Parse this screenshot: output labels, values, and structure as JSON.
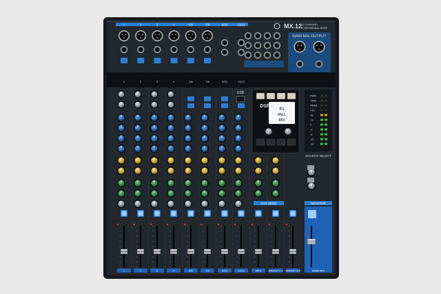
{
  "brand": {
    "model": "MX.12",
    "subtitle_line1": "12 CHANNEL",
    "subtitle_line2": "PROFESSIONAL MIXER"
  },
  "top_channel_labels": [
    "1",
    "2",
    "3",
    "4",
    "5/6",
    "7/8",
    "9/10",
    "11/12"
  ],
  "bottom_channel_labels": [
    "1",
    "2",
    "3",
    "4",
    "5/6",
    "7/8",
    "9/10",
    "11/12"
  ],
  "main_mix_output_label": "MAIN MIX OUTPUT",
  "usb_label": "USB",
  "dsp": {
    "label": "DSP",
    "display_lines": [
      "01",
      "HALL",
      "REV"
    ],
    "button_count": 8
  },
  "meter": {
    "labels": [
      "PWR",
      "+48V",
      "PEAK",
      "+10",
      "+6",
      "+3",
      "0",
      "-3",
      "-6",
      "-10",
      "-20"
    ],
    "left_level": 0.72,
    "right_level": 0.72
  },
  "aux_send_label": "AUX SEND",
  "source_select_label": "SOURCE SELECT",
  "monitor_label": "MONITOR",
  "fader_strips": [
    {
      "label": "1",
      "level": 0.38
    },
    {
      "label": "2",
      "level": 0.38
    },
    {
      "label": "3",
      "level": 0.38
    },
    {
      "label": "4",
      "level": 0.38
    },
    {
      "label": "5/6",
      "level": 0.38
    },
    {
      "label": "7/8",
      "level": 0.38
    },
    {
      "label": "9/10",
      "level": 0.38
    },
    {
      "label": "11/12",
      "level": 0.38
    },
    {
      "label": "DFX",
      "level": 0.38
    },
    {
      "label": "GROUP 1-2",
      "level": 0.38
    },
    {
      "label": "GROUP 3-4",
      "level": 0.38
    }
  ],
  "main_mix_fader": {
    "label": "MAIN MIX",
    "level": 0.62
  },
  "colors": {
    "body": "#20252a",
    "accent_blue": "#2a7fd4",
    "knob_blue": "#1f63b8",
    "knob_yellow": "#e0b322",
    "knob_green": "#2f8a3c",
    "knob_grey": "#8d949a"
  }
}
